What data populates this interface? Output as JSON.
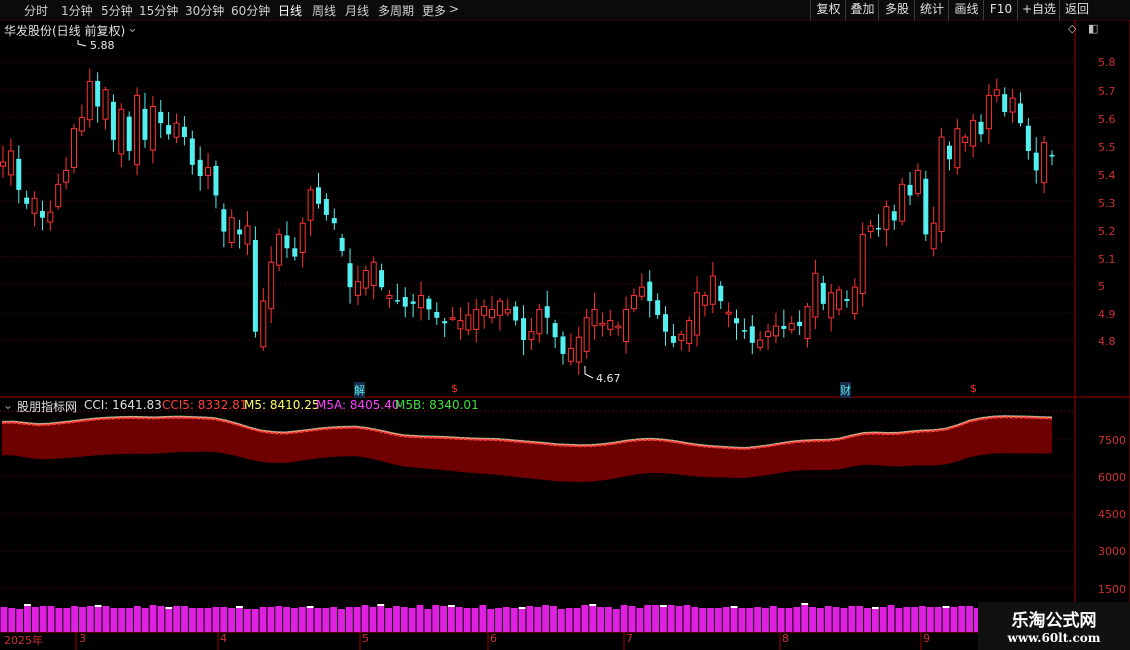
{
  "toolbar": {
    "periods": [
      "分时",
      "1分钟",
      "5分钟",
      "15分钟",
      "30分钟",
      "60分钟",
      "日线",
      "周线",
      "月线",
      "多周期",
      "更多"
    ],
    "active_period": "日线",
    "more_arrow": ">",
    "right_buttons": [
      "复权",
      "叠加",
      "多股",
      "统计",
      "画线",
      "F10",
      "+自选",
      "返回"
    ]
  },
  "main_chart": {
    "title": "华发股份(日线 前复权)",
    "high_marker": "5.88",
    "low_marker": "4.67",
    "event_markers": [
      "解",
      "$",
      "财",
      "$"
    ]
  },
  "indicator": {
    "name": "股朋指标网",
    "cci_label": "CCI: 1641.83",
    "cci5_label": "CCI5: 8332.81",
    "m5_label": "M5: 8410.25",
    "m5a_label": "M5A: 8405.40",
    "m5b_label": "M5B: 8340.01",
    "ticks": [
      "7500",
      "6000",
      "4500",
      "3000",
      "1500"
    ]
  },
  "colors": {
    "up": "#ff3232",
    "down": "#54f0f0",
    "cci5": "#ff4040",
    "m5": "#ffff66",
    "m5a": "#ff40ff",
    "m5b": "#40e040",
    "fill": "#6e0000",
    "bars": "#e020e0"
  },
  "chart_data": {
    "type": "candlestick",
    "y_ticks": [
      5.8,
      5.7,
      5.6,
      5.5,
      5.4,
      5.3,
      5.2,
      5.1,
      5.0,
      4.9,
      4.8
    ],
    "ylim": [
      4.7,
      5.9
    ],
    "x_tick_labels": [
      "2025年",
      "3",
      "4",
      "5",
      "6",
      "7",
      "8",
      "9"
    ],
    "closes": [
      5.44,
      5.48,
      5.34,
      5.29,
      5.31,
      5.24,
      5.26,
      5.36,
      5.41,
      5.56,
      5.6,
      5.73,
      5.64,
      5.7,
      5.52,
      5.63,
      5.48,
      5.68,
      5.52,
      5.64,
      5.58,
      5.54,
      5.58,
      5.53,
      5.43,
      5.39,
      5.42,
      5.32,
      5.19,
      5.24,
      5.18,
      5.21,
      4.83,
      4.94,
      5.08,
      5.18,
      5.13,
      5.1,
      5.22,
      5.34,
      5.29,
      5.25,
      5.22,
      5.12,
      4.99,
      5.01,
      5.05,
      5.08,
      4.99,
      4.96,
      4.94,
      4.92,
      4.93,
      4.96,
      4.91,
      4.88,
      4.86,
      4.88,
      4.87,
      4.89,
      4.91,
      4.92,
      4.91,
      4.94,
      4.91,
      4.87,
      4.8,
      4.83,
      4.91,
      4.88,
      4.81,
      4.75,
      4.77,
      4.81,
      4.88,
      4.91,
      4.86,
      4.87,
      4.85,
      4.91,
      4.96,
      4.99,
      4.94,
      4.89,
      4.83,
      4.79,
      4.82,
      4.87,
      4.97,
      4.96,
      5.03,
      4.94,
      4.9,
      4.86,
      4.83,
      4.79,
      4.8,
      4.83,
      4.85,
      4.84,
      4.86,
      4.85,
      4.92,
      5.04,
      4.93,
      4.97,
      4.98,
      4.94,
      4.99,
      5.18,
      5.21,
      5.2,
      5.28,
      5.23,
      5.36,
      5.32,
      5.41,
      5.18,
      5.22,
      5.53,
      5.45,
      5.56,
      5.53,
      5.59,
      5.54,
      5.68,
      5.7,
      5.62,
      5.67,
      5.58,
      5.48,
      5.41,
      5.51,
      5.46
    ],
    "cci5_values": [
      8150,
      8160,
      8110,
      8060,
      8080,
      8130,
      8180,
      8240,
      8290,
      8320,
      8340,
      8350,
      8340,
      8330,
      8350,
      8360,
      8345,
      8330,
      8300,
      8200,
      8070,
      7920,
      7800,
      7740,
      7720,
      7770,
      7830,
      7890,
      7930,
      7950,
      7960,
      7900,
      7810,
      7700,
      7610,
      7580,
      7560,
      7550,
      7530,
      7500,
      7480,
      7470,
      7460,
      7420,
      7380,
      7340,
      7300,
      7250,
      7230,
      7210,
      7220,
      7260,
      7320,
      7400,
      7450,
      7470,
      7440,
      7380,
      7300,
      7230,
      7180,
      7150,
      7120,
      7100,
      7150,
      7210,
      7290,
      7360,
      7400,
      7420,
      7430,
      7480,
      7600,
      7700,
      7720,
      7700,
      7710,
      7760,
      7800,
      7820,
      7880,
      8020,
      8200,
      8300,
      8360,
      8380,
      8370,
      8360,
      8340,
      8330
    ]
  }
}
